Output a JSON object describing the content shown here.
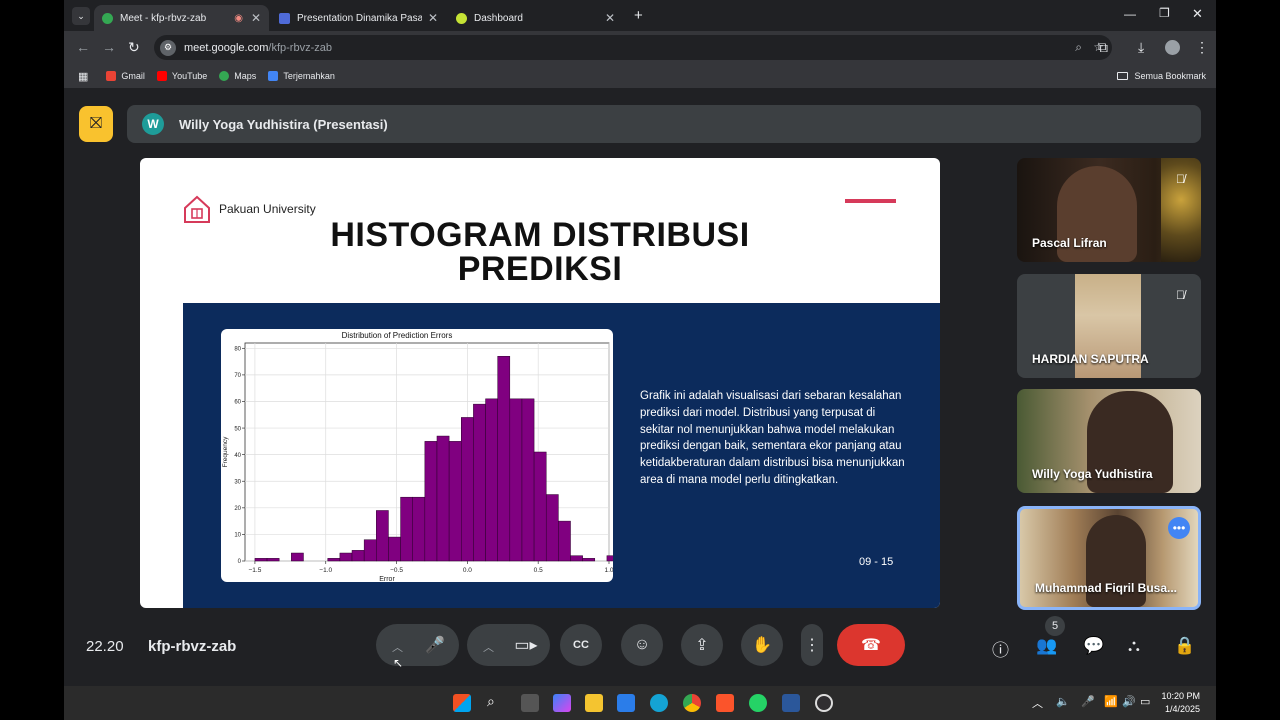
{
  "browser": {
    "tabs": [
      {
        "title": "Meet - kfp-rbvz-zab",
        "active": true
      },
      {
        "title": "Presentation Dinamika Pasar Re",
        "active": false
      },
      {
        "title": "Dashboard",
        "active": false
      }
    ],
    "url_host": "meet.google.com",
    "url_path": "/kfp-rbvz-zab",
    "bookmarks": [
      "Gmail",
      "YouTube",
      "Maps",
      "Terjemahkan"
    ],
    "all_bookmarks": "Semua Bookmark"
  },
  "meet": {
    "presenter": "Willy Yoga Yudhistira (Presentasi)",
    "presenter_initial": "W",
    "participants": [
      {
        "name": "Pascal Lifran",
        "muted": true
      },
      {
        "name": "HARDIAN SAPUTRA",
        "muted": true
      },
      {
        "name": "Willy Yoga Yudhistira",
        "muted": false
      },
      {
        "name": "Muhammad Fiqril Busa...",
        "muted": false
      }
    ],
    "time": "22.20",
    "code": "kfp-rbvz-zab",
    "participant_count": "5"
  },
  "slide": {
    "logo_text": "Pakuan University",
    "title_line1": "HISTOGRAM DISTRIBUSI",
    "title_line2": "PREDIKSI",
    "description": "Grafik ini adalah visualisasi dari sebaran kesalahan prediksi dari model. Distribusi yang terpusat di sekitar nol menunjukkan bahwa model melakukan prediksi dengan baik, sementara ekor panjang atau ketidakberaturan dalam distribusi bisa menunjukkan area di mana model perlu ditingkatkan.",
    "page": "09 - 15"
  },
  "chart_data": {
    "type": "bar",
    "title": "Distribution of Prediction Errors",
    "xlabel": "Error",
    "ylabel": "Frequency",
    "bin_start": -1.5,
    "bin_width": 0.0857,
    "values": [
      1,
      1,
      0,
      3,
      0,
      0,
      1,
      3,
      4,
      8,
      19,
      9,
      24,
      24,
      45,
      47,
      45,
      54,
      59,
      61,
      77,
      61,
      61,
      41,
      25,
      15,
      2,
      1,
      0,
      2
    ],
    "xlim": [
      -1.57,
      1.0
    ],
    "ylim": [
      0,
      82
    ],
    "xticks": [
      "−1.5",
      "−1.0",
      "−0.5",
      "0.0",
      "0.5",
      "1.0"
    ],
    "xtick_values": [
      -1.5,
      -1.0,
      -0.5,
      0.0,
      0.5,
      1.0
    ],
    "yticks": [
      "0",
      "10",
      "20",
      "30",
      "40",
      "50",
      "60",
      "70",
      "80"
    ],
    "ytick_values": [
      0,
      10,
      20,
      30,
      40,
      50,
      60,
      70,
      80
    ],
    "grid": true,
    "bar_color": "#800080"
  },
  "taskbar": {
    "time": "10:20 PM",
    "date": "1/4/2025"
  },
  "colors": {
    "endcall": "#dc362e",
    "slide_panel": "#0c2b5c",
    "accent": "#d63a5a",
    "present_icon": "#f9c22e"
  }
}
